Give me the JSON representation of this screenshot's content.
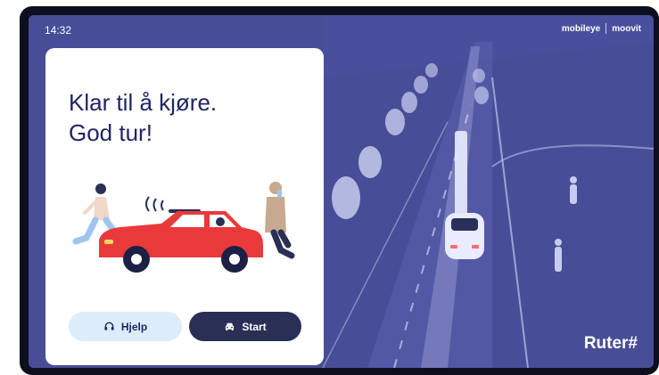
{
  "status_bar": {
    "time": "14:32"
  },
  "brands": {
    "mobileye": "mobileye",
    "moovit": "moovit",
    "operator": "Ruter#"
  },
  "card": {
    "headline_line1": "Klar til å kjøre.",
    "headline_line2": "God tur!",
    "help_label": "Hjelp",
    "start_label": "Start"
  },
  "icons": {
    "help": "headset-icon",
    "start": "car-icon"
  },
  "colors": {
    "scene_background": "#474d96",
    "road_highlight": "#e9ecff",
    "headline_text": "#1f2466",
    "help_button_bg": "#dcecfb",
    "start_button_bg": "#2a2f55",
    "car_red": "#e83a3a"
  }
}
